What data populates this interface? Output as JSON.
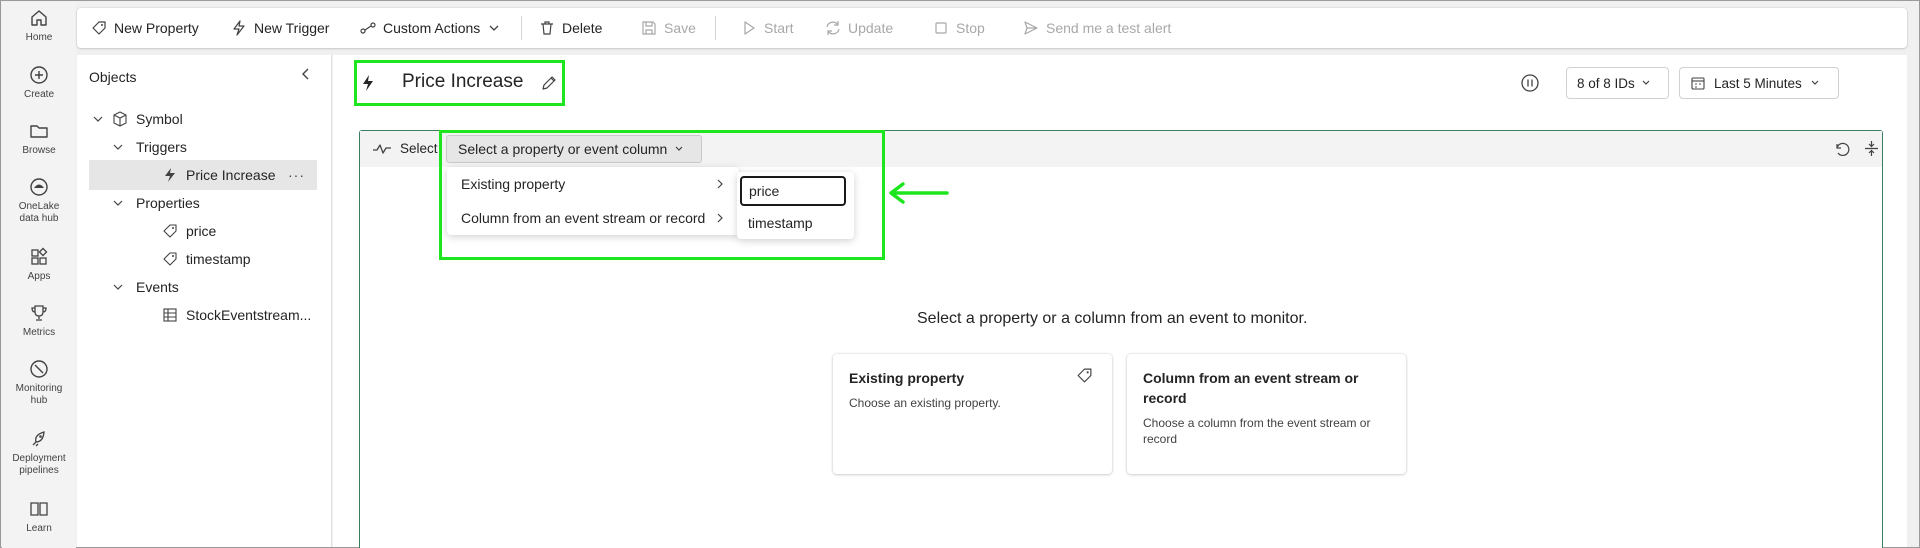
{
  "nav": {
    "items": [
      {
        "label": "Home",
        "icon": "home-icon"
      },
      {
        "label": "Create",
        "icon": "plus-circle-icon"
      },
      {
        "label": "Browse",
        "icon": "folder-icon"
      },
      {
        "label": "OneLake data hub",
        "line1": "OneLake",
        "line2": "data hub",
        "icon": "onelake-icon"
      },
      {
        "label": "Apps",
        "icon": "apps-icon"
      },
      {
        "label": "Metrics",
        "icon": "trophy-icon"
      },
      {
        "label": "Monitoring hub",
        "line1": "Monitoring",
        "line2": "hub",
        "icon": "monitor-icon"
      },
      {
        "label": "Deployment pipelines",
        "line1": "Deployment",
        "line2": "pipelines",
        "icon": "rocket-icon"
      },
      {
        "label": "Learn",
        "icon": "book-icon"
      }
    ]
  },
  "toolbar": {
    "new_property": "New Property",
    "new_trigger": "New Trigger",
    "custom_actions": "Custom Actions",
    "delete": "Delete",
    "save": "Save",
    "start": "Start",
    "update": "Update",
    "stop": "Stop",
    "test_alert": "Send me a test alert"
  },
  "objects": {
    "title": "Objects",
    "symbol": "Symbol",
    "triggers": "Triggers",
    "trigger_item": "Price Increase",
    "properties": "Properties",
    "property_1": "price",
    "property_2": "timestamp",
    "events": "Events",
    "event_item": "StockEventstream..."
  },
  "header": {
    "title": "Price Increase",
    "ids_filter": "8 of 8 IDs",
    "time_filter": "Last 5 Minutes"
  },
  "card": {
    "select_label": "Select",
    "select_button": "Select a property or event column"
  },
  "dropdown": {
    "items": [
      "Existing property",
      "Column from an event stream or record"
    ]
  },
  "submenu": {
    "input_value": "price",
    "item": "timestamp"
  },
  "empty_state": {
    "prompt": "Select a property or a column from an event to monitor.",
    "option_1_title": "Existing property",
    "option_1_desc": "Choose an existing property.",
    "option_2_title_1": "Column from an event stream or",
    "option_2_title_2": "record",
    "option_2_desc_1": "Choose a column from the event stream or",
    "option_2_desc_2": "record"
  },
  "colors": {
    "highlight": "#1ee61e",
    "card_border": "#3a7d5f",
    "disabled_text": "#a8a8a8"
  }
}
